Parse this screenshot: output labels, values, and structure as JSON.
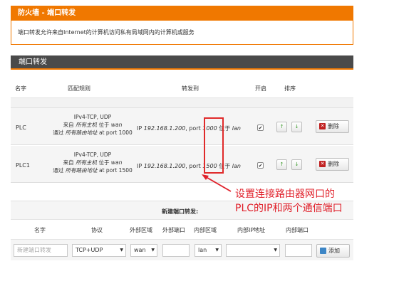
{
  "firewall": {
    "title": "防火墙 - 端口转发",
    "description": "端口转发允许来自Internet的计算机访问私有局域网内的计算机或服务"
  },
  "section": {
    "title": "端口转发"
  },
  "columns": {
    "name": "名字",
    "match": "匹配规则",
    "forward": "转发到",
    "enable": "开启",
    "sort": "排序"
  },
  "rules": [
    {
      "name": "PLC",
      "proto": "IPv4-TCP, UDP",
      "from_prefix": "来自",
      "from_host": "所有主机",
      "from_in": "位于",
      "from_zone": "wan",
      "via_prefix": "通过",
      "via_addr": "所有路由地址",
      "via_port": "at port 1000",
      "fwd_ip_prefix": "IP",
      "fwd_ip": "192.168.1.200",
      "fwd_port_prefix": ", port",
      "fwd_port": "1000",
      "fwd_in": "位于",
      "fwd_zone": "lan",
      "checked": "✔",
      "up": "↑",
      "down": "↓",
      "delete": "删除"
    },
    {
      "name": "PLC1",
      "proto": "IPv4-TCP, UDP",
      "from_prefix": "来自",
      "from_host": "所有主机",
      "from_in": "位于",
      "from_zone": "wan",
      "via_prefix": "通过",
      "via_addr": "所有路由地址",
      "via_port": "at port 1500",
      "fwd_ip_prefix": "IP",
      "fwd_ip": "192.168.1.200",
      "fwd_port_prefix": ", port",
      "fwd_port": "1500",
      "fwd_in": "位于",
      "fwd_zone": "lan",
      "checked": "✔",
      "up": "↑",
      "down": "↓",
      "delete": "删除"
    }
  ],
  "annotation": {
    "line1": "设置连接路由器网口的",
    "line2": "PLC的IP和两个通信端口"
  },
  "new_forward": {
    "title": "新建端口转发:",
    "cols": {
      "name": "名字",
      "proto": "协议",
      "ext_zone": "外部区域",
      "ext_port": "外部端口",
      "int_zone": "内部区域",
      "int_ip": "内部IP地址",
      "int_port": "内部端口"
    },
    "name_placeholder": "新建端口转发",
    "proto_value": "TCP+UDP",
    "ext_zone_value": "wan",
    "int_zone_value": "lan",
    "add_label": "添加"
  },
  "colors": {
    "accent": "#f07800",
    "annotation": "#e0202a",
    "header_dark": "#4a4a4a"
  }
}
